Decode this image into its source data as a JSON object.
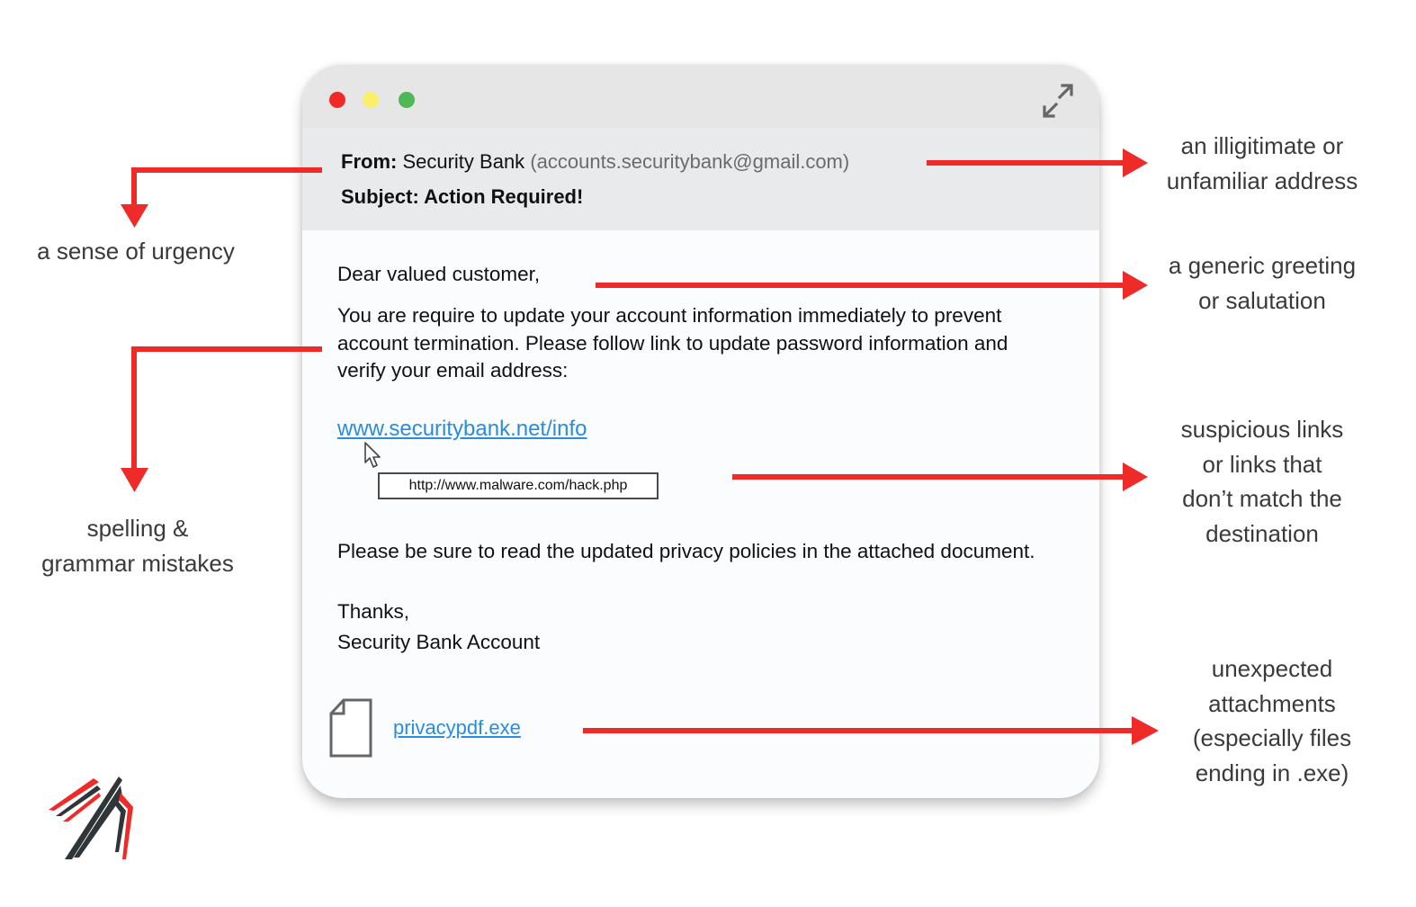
{
  "window": {
    "controls": {
      "close_color": "#ee2b29",
      "minimize_color": "#fbee6b",
      "maximize_color": "#4fb755",
      "expand_icon": "expand-arrows-icon"
    }
  },
  "email": {
    "from_label": "From:",
    "from_name": "Security Bank",
    "from_address": "(accounts.securitybank@gmail.com)",
    "subject_label": "Subject:",
    "subject": "Action Required!",
    "greeting": "Dear valued customer,",
    "paragraph1": "You are require to update your account information immediately to prevent account termination. Please follow link to update password information and verify your email address:",
    "link_text": "www.securitybank.net/info",
    "link_tooltip": "http://www.malware.com/hack.php",
    "paragraph2": "Please be sure to read the updated privacy policies in the attached document.",
    "closing": "Thanks,",
    "signature": "Security Bank Account",
    "attachment_name": "privacypdf.exe",
    "attachment_icon": "file-icon"
  },
  "annotations": {
    "urgency": "a sense of urgency",
    "spelling": [
      "spelling &",
      "grammar mistakes"
    ],
    "address": [
      "an illigitimate or",
      "unfamiliar address"
    ],
    "greeting": [
      "a generic greeting",
      "or salutation"
    ],
    "links": [
      "suspicious links",
      "or links that",
      "don’t match the",
      "destination"
    ],
    "attachments": [
      "unexpected",
      "attachments",
      "(especially files",
      "ending in .exe)"
    ]
  },
  "colors": {
    "arrow": "#ee2b29",
    "link": "#2a8ce0",
    "annotation_text": "#3a3a3a"
  }
}
